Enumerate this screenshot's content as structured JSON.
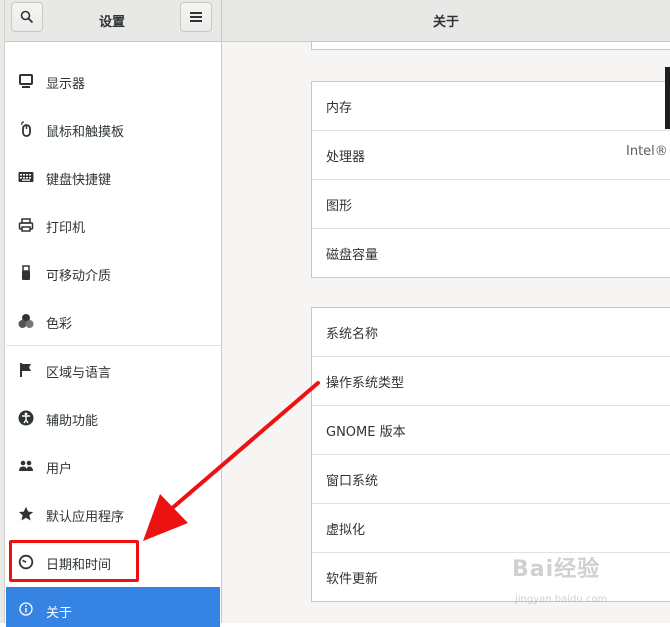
{
  "header": {
    "sidebar_title": "设置",
    "main_title": "关于",
    "search_icon": "search-icon",
    "menu_icon": "hamburger-menu-icon"
  },
  "sidebar": {
    "items": [
      {
        "label": "显示器",
        "icon": "display-icon"
      },
      {
        "label": "鼠标和触摸板",
        "icon": "mouse-icon"
      },
      {
        "label": "键盘快捷键",
        "icon": "keyboard-icon"
      },
      {
        "label": "打印机",
        "icon": "printer-icon"
      },
      {
        "label": "可移动介质",
        "icon": "removable-media-icon"
      },
      {
        "label": "色彩",
        "icon": "color-icon"
      },
      {
        "label": "区域与语言",
        "icon": "flag-icon"
      },
      {
        "label": "辅助功能",
        "icon": "accessibility-icon"
      },
      {
        "label": "用户",
        "icon": "users-icon"
      },
      {
        "label": "默认应用程序",
        "icon": "star-icon"
      },
      {
        "label": "日期和时间",
        "icon": "clock-icon"
      },
      {
        "label": "关于",
        "icon": "info-icon"
      }
    ],
    "selected": "关于",
    "highlighted": "日期和时间"
  },
  "main": {
    "hardware": [
      {
        "label": "内存",
        "value": ""
      },
      {
        "label": "处理器",
        "value": "Intel®"
      },
      {
        "label": "图形",
        "value": ""
      },
      {
        "label": "磁盘容量",
        "value": ""
      }
    ],
    "software": [
      {
        "label": "系统名称"
      },
      {
        "label": "操作系统类型"
      },
      {
        "label": "GNOME 版本"
      },
      {
        "label": "窗口系统"
      },
      {
        "label": "虚拟化"
      },
      {
        "label": "软件更新"
      }
    ]
  },
  "colors": {
    "accent": "#3584e4",
    "annotation_red": "#ee1111",
    "header_bg": "#e8e8e7",
    "content_bg": "#f6f5f4"
  },
  "watermark": {
    "text": "Bai经验",
    "sub": "jingyan.baidu.com"
  }
}
